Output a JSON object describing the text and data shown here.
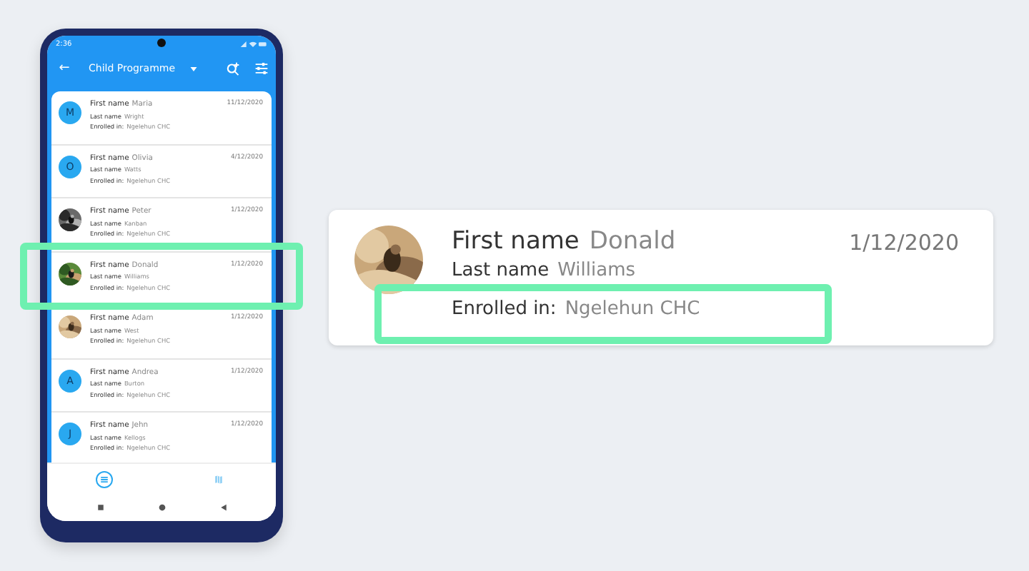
{
  "phone": {
    "status_bar": {
      "time": "2:36"
    },
    "app_bar": {
      "back": "←",
      "title": "Child Programme"
    },
    "list": [
      {
        "avatar": {
          "kind": "letter",
          "letter": "M"
        },
        "first_name_label": "First name",
        "first_name": "Maria",
        "last_name_label": "Last name",
        "last_name": "Wright",
        "enrolled_label": "Enrolled in:",
        "enrolled": "Ngelehun CHC",
        "date": "11/12/2020"
      },
      {
        "avatar": {
          "kind": "letter",
          "letter": "O"
        },
        "first_name_label": "First name",
        "first_name": "Olivia",
        "last_name_label": "Last name",
        "last_name": "Watts",
        "enrolled_label": "Enrolled in:",
        "enrolled": "Ngelehun CHC",
        "date": "4/12/2020"
      },
      {
        "first_name_label": "First name",
        "first_name": "Peter",
        "last_name_label": "Last name",
        "last_name": "Kanban",
        "enrolled_label": "Enrolled in:",
        "enrolled": "Ngelehun CHC",
        "date": "1/12/2020"
      },
      {
        "first_name_label": "First name",
        "first_name": "Donald",
        "last_name_label": "Last name",
        "last_name": "Williams",
        "enrolled_label": "Enrolled in:",
        "enrolled": "Ngelehun CHC",
        "date": "1/12/2020"
      },
      {
        "first_name_label": "First name",
        "first_name": "Adam",
        "last_name_label": "Last name",
        "last_name": "West",
        "enrolled_label": "Enrolled in:",
        "enrolled": "Ngelehun CHC",
        "date": "1/12/2020"
      },
      {
        "avatar": {
          "kind": "letter",
          "letter": "A"
        },
        "first_name_label": "First name",
        "first_name": "Andrea",
        "last_name_label": "Last name",
        "last_name": "Burton",
        "enrolled_label": "Enrolled in:",
        "enrolled": "Ngelehun CHC",
        "date": "1/12/2020"
      },
      {
        "avatar": {
          "kind": "letter",
          "letter": "J"
        },
        "first_name_label": "First name",
        "first_name": "Jehn",
        "last_name_label": "Last name",
        "last_name": "Kellogs",
        "enrolled_label": "Enrolled in:",
        "enrolled": "Ngelehun CHC",
        "date": "1/12/2020"
      }
    ],
    "bottom_nav": [
      {
        "kind": "list",
        "selected": true
      },
      {
        "kind": "map",
        "selected": false
      }
    ]
  },
  "detail_card": {
    "first_name_label": "First name",
    "first_name": "Donald",
    "last_name_label": "Last name",
    "last_name": "Williams",
    "enrolled_label": "Enrolled in:",
    "enrolled": "Ngelehun CHC",
    "date": "1/12/2020"
  }
}
